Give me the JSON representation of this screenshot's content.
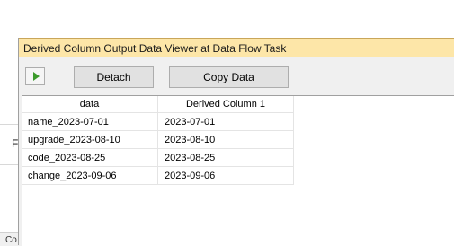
{
  "background": {
    "panel_text": "F",
    "bottom_text": "Co"
  },
  "viewer": {
    "title": "Derived Column Output Data Viewer at Data Flow Task",
    "toolbar": {
      "play_icon": "play-icon",
      "detach_label": "Detach",
      "copy_label": "Copy Data"
    },
    "grid": {
      "columns": [
        "data",
        "Derived Column 1"
      ],
      "rows": [
        [
          "name_2023-07-01",
          "2023-07-01"
        ],
        [
          "upgrade_2023-08-10",
          "2023-08-10"
        ],
        [
          "code_2023-08-25",
          "2023-08-25"
        ],
        [
          "change_2023-09-06",
          "2023-09-06"
        ]
      ]
    }
  },
  "colors": {
    "titlebar": "#fde6a8",
    "play_icon": "#3b9a2b",
    "window_bg": "#f0f0f0"
  }
}
